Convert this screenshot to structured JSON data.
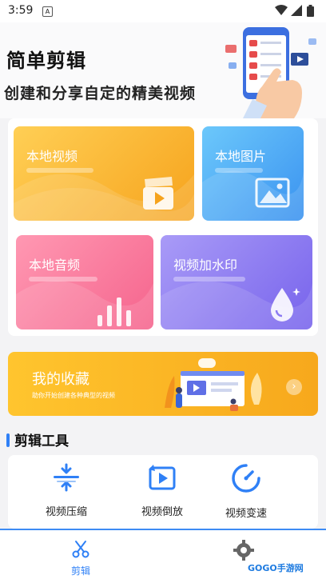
{
  "status_bar": {
    "time": "3:59",
    "notification_badge": "A"
  },
  "hero": {
    "title": "简单剪辑",
    "subtitle": "创建和分享自定的精美视频"
  },
  "cards": [
    {
      "label": "本地视频",
      "icon": "clapperboard-icon",
      "color": "#f9b233"
    },
    {
      "label": "本地图片",
      "icon": "image-icon",
      "color": "#4aa3f5"
    },
    {
      "label": "本地音频",
      "icon": "audio-bars-icon",
      "color": "#f77a9b"
    },
    {
      "label": "视频加水印",
      "icon": "drop-icon",
      "color": "#8d7cf2"
    }
  ],
  "collection": {
    "title": "我的收藏",
    "description": "助你开始创建各种典型的视频"
  },
  "tools_section": {
    "title": "剪辑工具",
    "accent": "#2f80f6",
    "items": [
      {
        "label": "视频压缩",
        "icon": "compress-icon"
      },
      {
        "label": "视频倒放",
        "icon": "reverse-play-icon"
      },
      {
        "label": "视频变速",
        "icon": "speed-icon"
      }
    ]
  },
  "tab_bar": {
    "tabs": [
      {
        "label": "剪辑",
        "icon": "scissors-icon",
        "active": true
      },
      {
        "label": "",
        "icon": "gear-icon",
        "active": false
      }
    ]
  },
  "watermark": "GOGO手游网"
}
